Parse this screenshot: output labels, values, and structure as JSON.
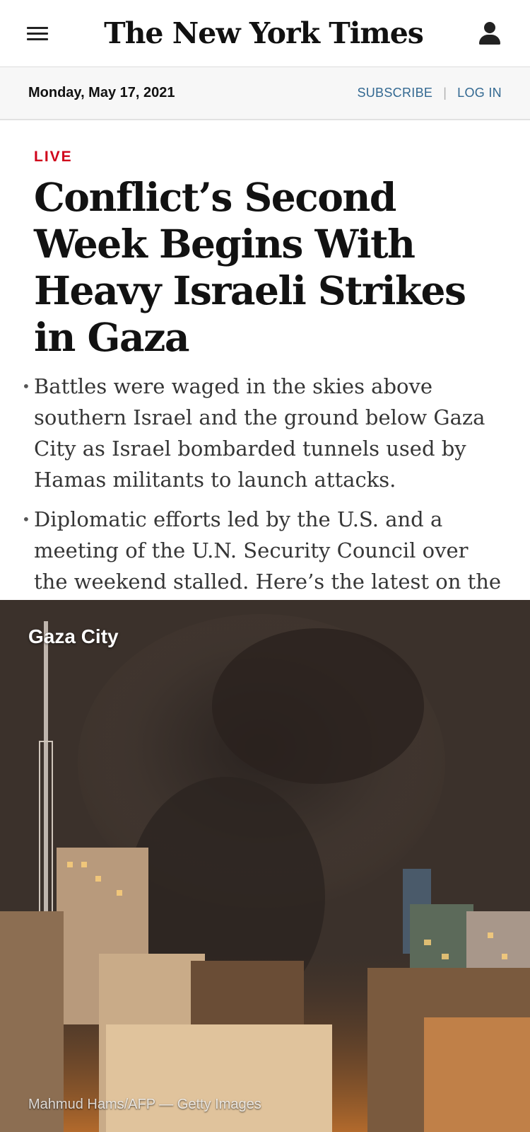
{
  "header": {
    "masthead": "The New York Times",
    "menu_icon": "menu-icon",
    "account_icon": "account-icon"
  },
  "subbar": {
    "date": "Monday, May 17, 2021",
    "subscribe_label": "SUBSCRIBE",
    "separator": "|",
    "login_label": "LOG IN"
  },
  "article": {
    "badge": "LIVE",
    "headline": "Conflict’s Second Week Begins With Heavy Israeli Strikes in Gaza",
    "bullets": [
      "Battles were waged in the skies above southern Israel and the ground below Gaza City as Israel bombarded tunnels used by Hamas militants to launch attacks.",
      "Diplomatic efforts led by the U.S. and a meeting of the U.N. Security Council over the weekend stalled. Here’s the latest on the conflict."
    ]
  },
  "image": {
    "location_label": "Gaza City",
    "credit": "Mahmud Hams/AFP — Getty Images"
  },
  "colors": {
    "live_red": "#d0021b",
    "link_blue": "#326891",
    "text_dark": "#121212",
    "subbar_bg": "#f7f7f7"
  }
}
